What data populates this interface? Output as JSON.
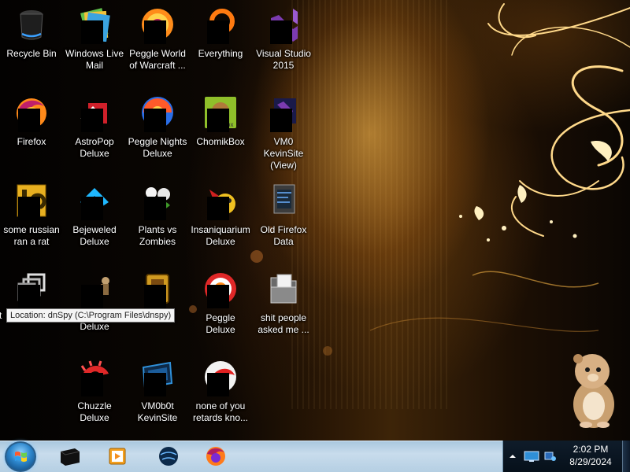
{
  "desktop": {
    "icons": [
      {
        "label": "Recycle Bin",
        "icon": "recycle-bin-icon"
      },
      {
        "label": "Windows Live Mail",
        "icon": "windows-live-mail-icon"
      },
      {
        "label": "Peggle World of Warcraft ...",
        "icon": "peggle-icon"
      },
      {
        "label": "Everything",
        "icon": "everything-icon"
      },
      {
        "label": "Visual Studio 2015",
        "icon": "visual-studio-icon"
      },
      {
        "label": "Firefox",
        "icon": "firefox-icon"
      },
      {
        "label": "AstroPop Deluxe",
        "icon": "astropop-icon"
      },
      {
        "label": "Peggle Nights Deluxe",
        "icon": "peggle-nights-icon"
      },
      {
        "label": "ChomikBox",
        "icon": "chomikbox-icon"
      },
      {
        "label": "VM0 KevinSite (View)",
        "icon": "visual-studio-icon"
      },
      {
        "label": "some russian ran a rat",
        "icon": "document-e-icon"
      },
      {
        "label": "Bejeweled Deluxe",
        "icon": "bejeweled-icon"
      },
      {
        "label": "Plants vs Zombies",
        "icon": "plants-vs-zombies-icon"
      },
      {
        "label": "Insaniquarium Deluxe",
        "icon": "insaniquarium-icon"
      },
      {
        "label": "Old Firefox Data",
        "icon": "folder-icon"
      },
      {
        "label": "t",
        "icon": "shortcut-stack-icon"
      },
      {
        "label": "Deluxe",
        "icon": "game-icon"
      },
      {
        "label": "",
        "icon": "app-icon"
      },
      {
        "label": "Peggle Deluxe",
        "icon": "peggle-icon"
      },
      {
        "label": "shit people asked me ...",
        "icon": "folder-icon"
      },
      {
        "label": "Chuzzle Deluxe",
        "icon": "chuzzle-icon"
      },
      {
        "label": "VM0b0t KevinSite",
        "icon": "vm-monitor-icon"
      },
      {
        "label": "none of you retards kno...",
        "icon": "red-app-icon"
      }
    ],
    "tooltip": "Location: dnSpy (C:\\Program Files\\dnspy)"
  },
  "taskbar": {
    "start": "windows-start-icon",
    "pinned": [
      {
        "icon": "monitor-app-icon"
      },
      {
        "icon": "media-player-icon"
      },
      {
        "icon": "globe-icon"
      },
      {
        "icon": "firefox-icon"
      }
    ],
    "tray": {
      "overflow": "chevron-up-icon",
      "icons": [
        "monitor-tray-icon",
        "network-tray-icon"
      ],
      "time": "2:02 PM",
      "date": "8/29/2024"
    }
  },
  "colors": {
    "taskbar": "#b5cfe3",
    "tray": "#0f1c2a",
    "accent_gold": "#f2b544"
  }
}
